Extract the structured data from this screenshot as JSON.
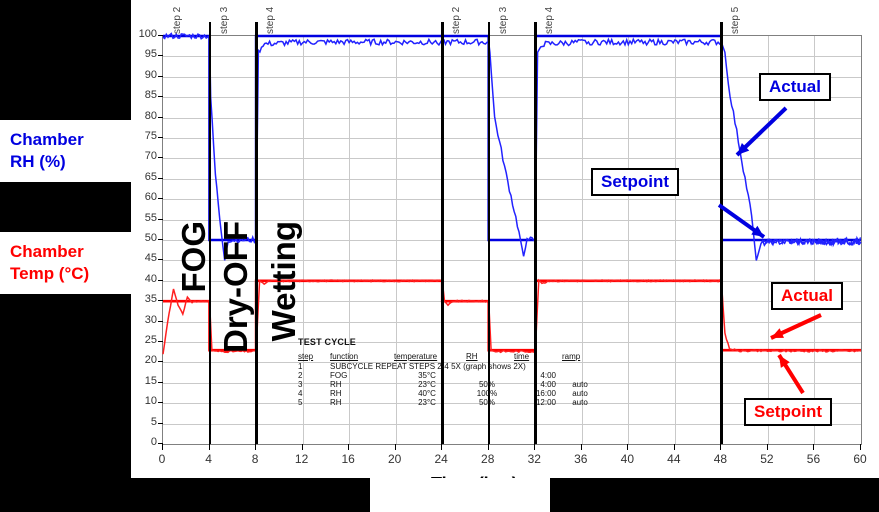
{
  "legend": {
    "rh": {
      "line1": "Chamber",
      "line2": "RH (%)",
      "color": "#0000E0"
    },
    "temp": {
      "line1": "Chamber",
      "line2": "Temp (°C)",
      "color": "#FF0000"
    }
  },
  "axes": {
    "x_title": "Time (hrs)",
    "x_ticks": [
      0,
      4,
      8,
      12,
      16,
      20,
      24,
      28,
      32,
      36,
      40,
      44,
      48,
      52,
      56,
      60
    ],
    "y_ticks": [
      0,
      5,
      10,
      15,
      20,
      25,
      30,
      35,
      40,
      45,
      50,
      55,
      60,
      65,
      70,
      75,
      80,
      85,
      90,
      95,
      100
    ]
  },
  "dividers": [
    {
      "hour": 4,
      "label": "step 2"
    },
    {
      "hour": 8,
      "label": "step 3"
    },
    {
      "hour": 24,
      "label": "step 4"
    },
    {
      "hour": 28,
      "label": "step 2"
    },
    {
      "hour": 32,
      "label": "step 3"
    },
    {
      "hour": 48,
      "label": "step 5"
    }
  ],
  "step_marks": [
    {
      "hour": 0,
      "label": "step 2"
    },
    {
      "hour": 4,
      "label": "step 3"
    },
    {
      "hour": 8,
      "label": "step 4"
    },
    {
      "hour": 24,
      "label": "step 2"
    },
    {
      "hour": 28,
      "label": "step 3"
    },
    {
      "hour": 32,
      "label": "step 4"
    },
    {
      "hour": 48,
      "label": "step 5"
    }
  ],
  "zone_labels": [
    {
      "text": "FOG",
      "hour": 1.6
    },
    {
      "text": "Dry-OFF",
      "hour": 5.4
    },
    {
      "text": "Wetting",
      "hour": 9.6
    }
  ],
  "callouts": [
    {
      "text": "Actual",
      "color": "#0000E0",
      "id": "blue-actual"
    },
    {
      "text": "Setpoint",
      "color": "#0000E0",
      "id": "blue-setpoint"
    },
    {
      "text": "Actual",
      "color": "#FF0000",
      "id": "red-actual"
    },
    {
      "text": "Setpoint",
      "color": "#FF0000",
      "id": "red-setpoint"
    }
  ],
  "test_cycle": {
    "title": "TEST CYCLE",
    "headers": [
      "step",
      "function",
      "temperature",
      "RH",
      "time",
      "ramp"
    ],
    "rows": [
      {
        "step": "1",
        "note": "SUBCYCLE REPEAT STEPS 2-4 5X (graph shows 2X)"
      },
      {
        "step": "2",
        "function": "FOG",
        "temperature": "35°C",
        "rh": "",
        "time": "4:00",
        "ramp": ""
      },
      {
        "step": "3",
        "function": "RH",
        "temperature": "23°C",
        "rh": "50%",
        "time": "4:00",
        "ramp": "auto"
      },
      {
        "step": "4",
        "function": "RH",
        "temperature": "40°C",
        "rh": "100%",
        "time": "16:00",
        "ramp": "auto"
      },
      {
        "step": "5",
        "function": "RH",
        "temperature": "23°C",
        "rh": "50%",
        "time": "12:00",
        "ramp": "auto"
      }
    ]
  },
  "chart_data": {
    "type": "line",
    "title": "",
    "xlabel": "Time (hrs)",
    "ylabel": "",
    "xlim": [
      0,
      60
    ],
    "ylim": [
      0,
      100
    ],
    "grid": true,
    "legend_position": "left-external",
    "series": [
      {
        "name": "Chamber RH (%) Setpoint",
        "color": "#0000E0",
        "style": "step",
        "points": [
          [
            0,
            100
          ],
          [
            4,
            100
          ],
          [
            4,
            50
          ],
          [
            8,
            50
          ],
          [
            8,
            100
          ],
          [
            24,
            100
          ],
          [
            28,
            100
          ],
          [
            28,
            50
          ],
          [
            32,
            50
          ],
          [
            32,
            100
          ],
          [
            48,
            100
          ],
          [
            48,
            50
          ],
          [
            60,
            50
          ]
        ]
      },
      {
        "name": "Chamber RH (%) Actual",
        "color": "#2222FF",
        "style": "noisy",
        "points": [
          [
            0,
            100
          ],
          [
            4,
            100
          ],
          [
            4.1,
            85
          ],
          [
            4.5,
            66
          ],
          [
            5.0,
            52
          ],
          [
            5.3,
            45
          ],
          [
            5.6,
            50
          ],
          [
            6,
            50
          ],
          [
            8,
            50
          ],
          [
            8.2,
            96
          ],
          [
            8.6,
            98
          ],
          [
            12,
            98.5
          ],
          [
            24,
            98.5
          ],
          [
            28,
            98.5
          ],
          [
            28.1,
            96
          ],
          [
            28.5,
            80
          ],
          [
            29.5,
            66
          ],
          [
            30.6,
            52
          ],
          [
            31.0,
            46
          ],
          [
            31.3,
            50
          ],
          [
            32,
            50
          ],
          [
            32.2,
            96
          ],
          [
            32.6,
            98
          ],
          [
            36,
            98.5
          ],
          [
            48,
            98.5
          ],
          [
            48.3,
            96
          ],
          [
            48.6,
            88
          ],
          [
            49.6,
            72
          ],
          [
            50.6,
            56
          ],
          [
            51.0,
            45
          ],
          [
            51.4,
            49
          ],
          [
            52,
            49.5
          ],
          [
            60,
            49.5
          ]
        ]
      },
      {
        "name": "Chamber Temp (°C) Setpoint",
        "color": "#FF0000",
        "style": "step",
        "points": [
          [
            0,
            35
          ],
          [
            4,
            35
          ],
          [
            4,
            23
          ],
          [
            8,
            23
          ],
          [
            8,
            40
          ],
          [
            24,
            40
          ],
          [
            24,
            35
          ],
          [
            28,
            35
          ],
          [
            28,
            23
          ],
          [
            32,
            23
          ],
          [
            32,
            40
          ],
          [
            48,
            40
          ],
          [
            48,
            23
          ],
          [
            60,
            23
          ]
        ]
      },
      {
        "name": "Chamber Temp (°C) Actual",
        "color": "#FF2020",
        "style": "overshoot",
        "points": [
          [
            0,
            22
          ],
          [
            0.4,
            30
          ],
          [
            0.9,
            38
          ],
          [
            1.3,
            34
          ],
          [
            1.7,
            32
          ],
          [
            2.1,
            36
          ],
          [
            2.5,
            34.6
          ],
          [
            3,
            35
          ],
          [
            4,
            35
          ],
          [
            4.2,
            23
          ],
          [
            4.6,
            22.7
          ],
          [
            8,
            22.7
          ],
          [
            8.3,
            40
          ],
          [
            8.7,
            39.3
          ],
          [
            9.2,
            40
          ],
          [
            24,
            40
          ],
          [
            24.2,
            35
          ],
          [
            24.5,
            34
          ],
          [
            25,
            35
          ],
          [
            28,
            35
          ],
          [
            28.2,
            23
          ],
          [
            28.6,
            22.7
          ],
          [
            32,
            22.7
          ],
          [
            32.3,
            40
          ],
          [
            32.7,
            39.3
          ],
          [
            33.2,
            40
          ],
          [
            48,
            40
          ],
          [
            48.3,
            27
          ],
          [
            48.7,
            23.4
          ],
          [
            49.4,
            22.8
          ],
          [
            60,
            22.8
          ]
        ]
      }
    ]
  }
}
